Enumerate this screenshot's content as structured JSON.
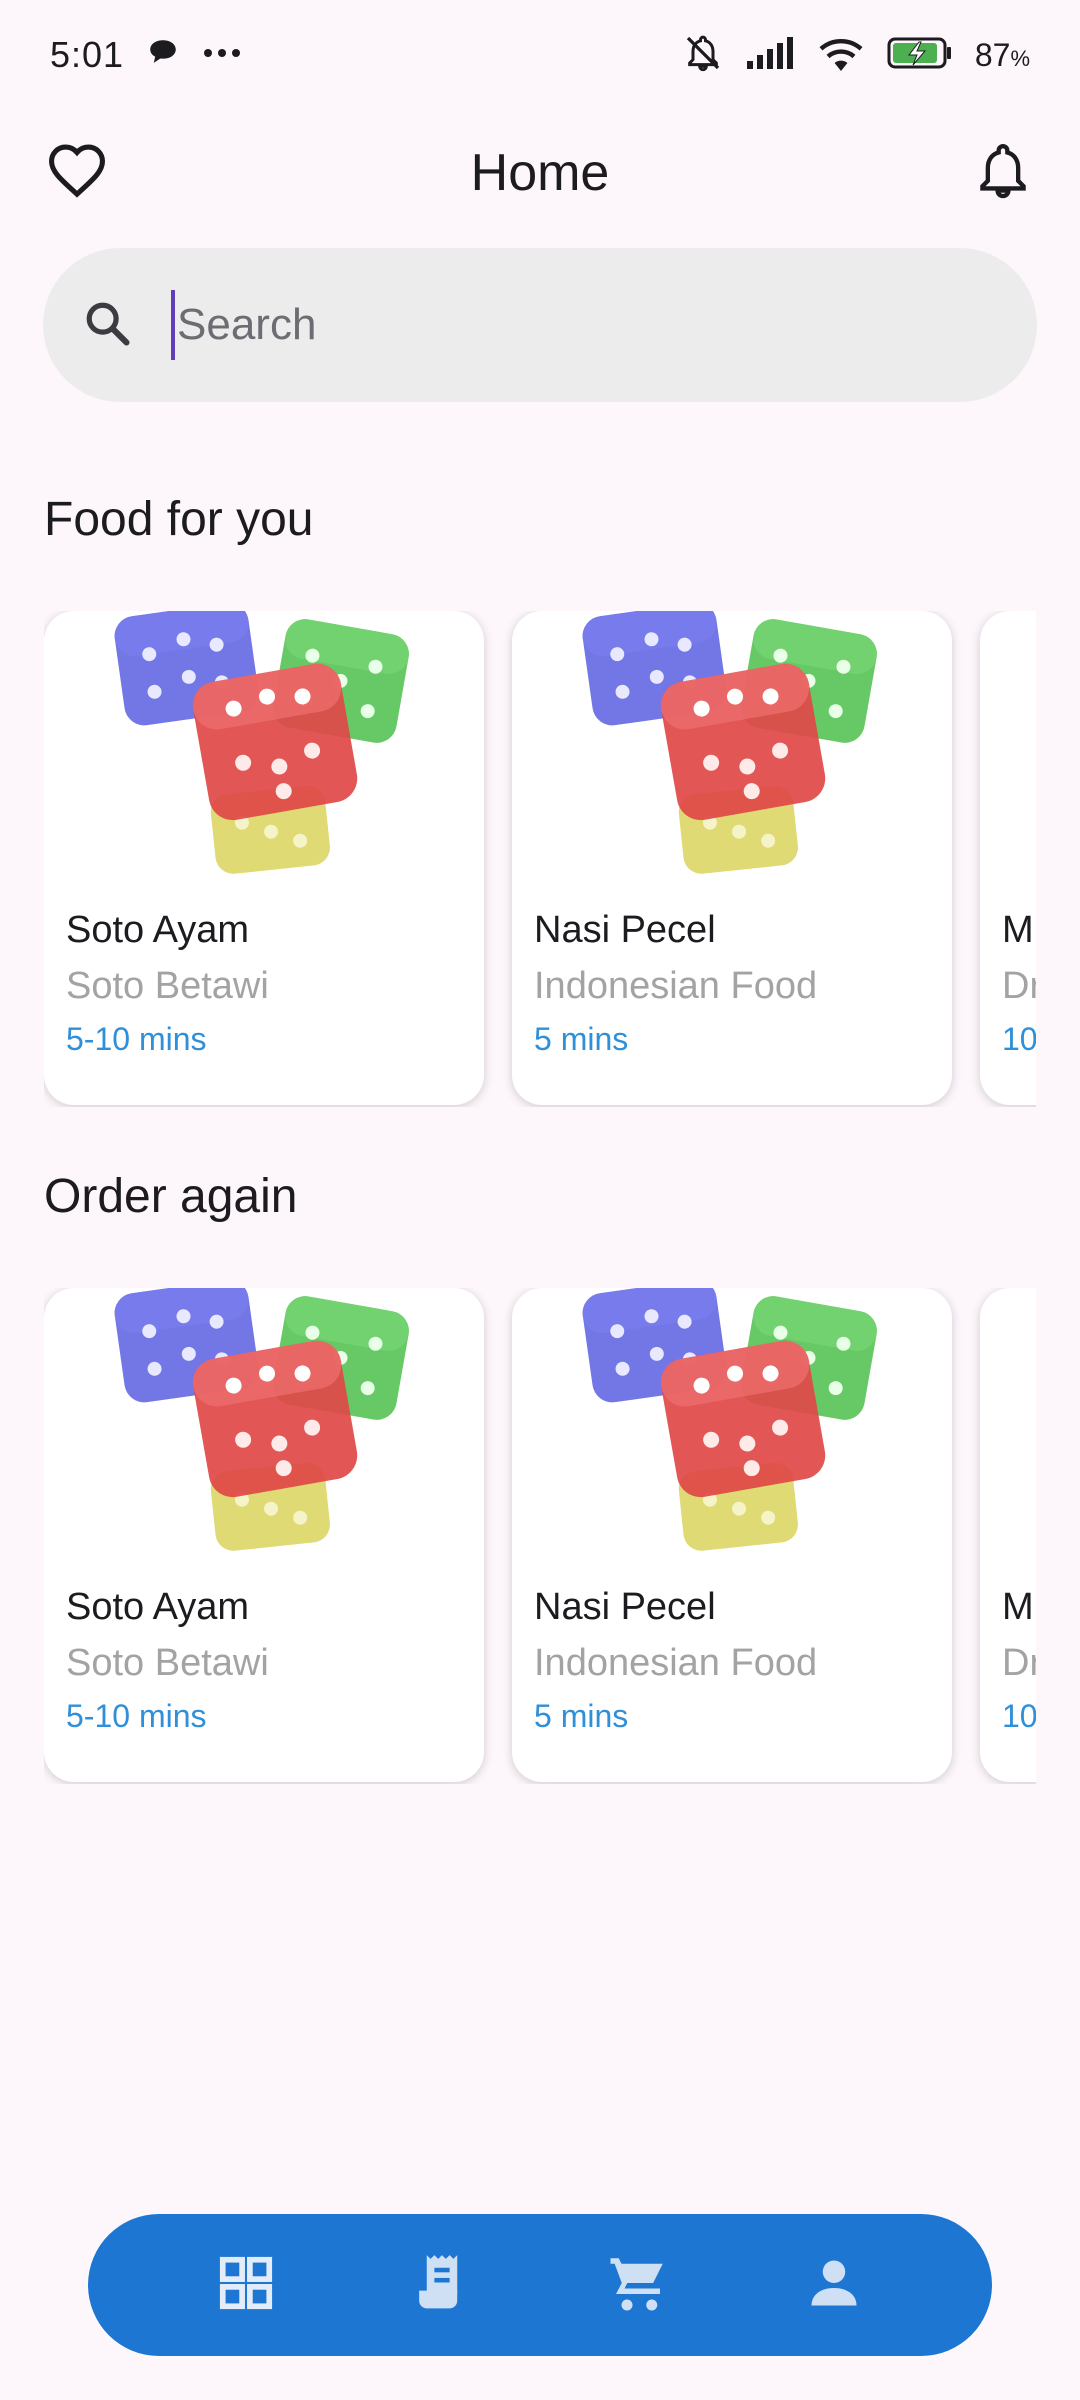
{
  "status_bar": {
    "time": "5:01",
    "battery_percent": "87",
    "battery_unit": "%",
    "icons": [
      "chat-bubble-icon",
      "more-dots-icon",
      "bell-off-icon",
      "signal-icon",
      "wifi-icon",
      "battery-charging-icon"
    ]
  },
  "app_bar": {
    "title": "Home",
    "left_icon": "heart-icon",
    "right_icon": "bell-icon"
  },
  "search": {
    "placeholder": "Search",
    "value": "",
    "icon": "search-icon"
  },
  "sections": [
    {
      "title": "Food for you",
      "items": [
        {
          "name": "Soto Ayam",
          "category": "Soto Betawi",
          "time": "5-10 mins"
        },
        {
          "name": "Nasi Pecel",
          "category": "Indonesian Food",
          "time": "5 mins"
        },
        {
          "name": "M",
          "category": "Dr",
          "time": "10"
        }
      ]
    },
    {
      "title": "Order again",
      "items": [
        {
          "name": "Soto Ayam",
          "category": "Soto Betawi",
          "time": "5-10 mins"
        },
        {
          "name": "Nasi Pecel",
          "category": "Indonesian Food",
          "time": "5 mins"
        },
        {
          "name": "M",
          "category": "Dr",
          "time": "10"
        }
      ]
    }
  ],
  "bottom_nav": {
    "items": [
      "dashboard-icon",
      "receipt-icon",
      "cart-icon",
      "person-icon"
    ]
  },
  "colors": {
    "background": "#fdf7fc",
    "nav_bar": "#1c76d2",
    "time_text": "#2f8fd8",
    "subtitle_text": "#a3a3a3",
    "search_bg": "#ececec",
    "cursor": "#5e3fb8"
  }
}
